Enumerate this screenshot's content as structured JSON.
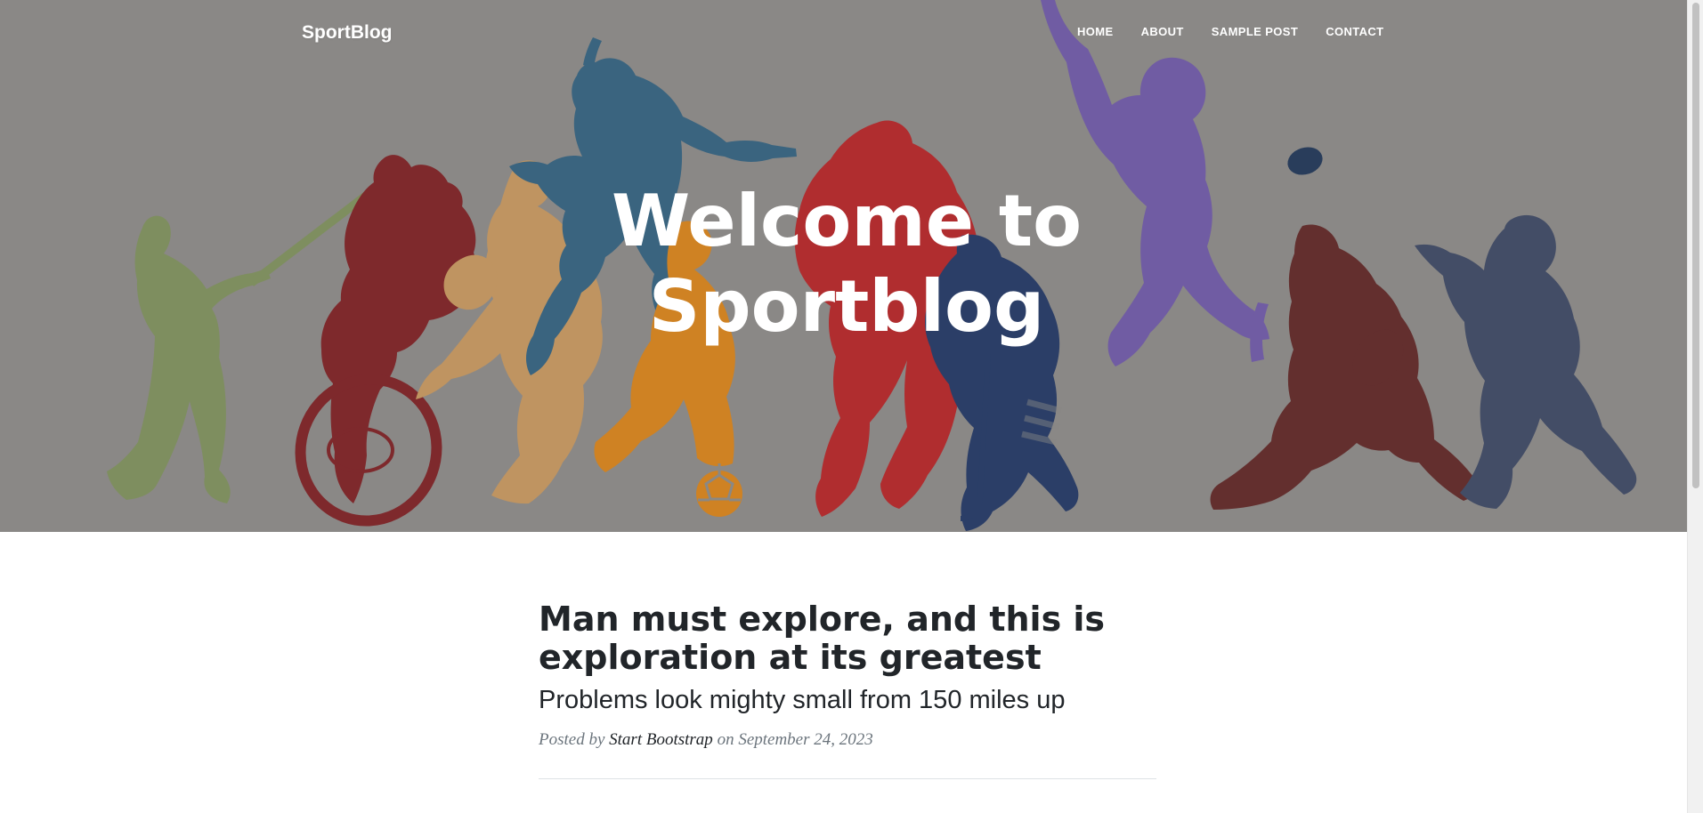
{
  "site": {
    "brand": "SportBlog"
  },
  "nav": {
    "items": [
      {
        "label": "HOME"
      },
      {
        "label": "ABOUT"
      },
      {
        "label": "SAMPLE POST"
      },
      {
        "label": "CONTACT"
      }
    ]
  },
  "hero": {
    "heading_line_1": "Welcome to",
    "heading_line_2": "Sportblog"
  },
  "post": {
    "title": "Man must explore, and this is exploration at its greatest",
    "subtitle": "Problems look mighty small from 150 miles up",
    "meta_prefix": "Posted by ",
    "author": "Start Bootstrap",
    "meta_date": " on September 24, 2023"
  },
  "colors": {
    "hero_overlay": "#8a8886",
    "golfer": "#7d8f5a",
    "cyclist": "#7d1c20",
    "pitcher": "#c6965d",
    "volleyball": "#2f5f7f",
    "soccer": "#d98116",
    "runner": "#b52024",
    "hockey": "#1e3464",
    "basketball": "#6d56a8",
    "rugby": "#5e2323",
    "football": "#3a4562"
  }
}
